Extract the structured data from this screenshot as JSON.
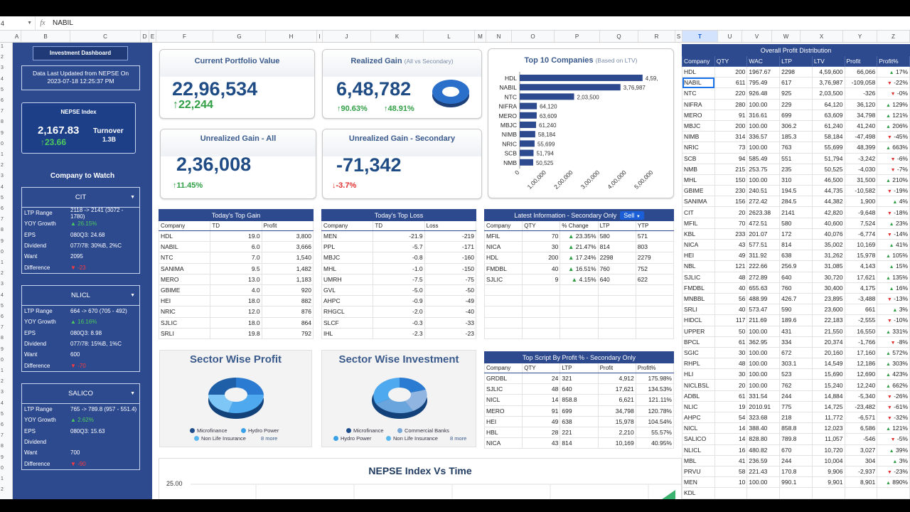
{
  "formula_bar": {
    "cell_ref": "4",
    "fx": "fx",
    "value": "NABIL"
  },
  "columns": [
    "A",
    "B",
    "C",
    "D",
    "E",
    "F",
    "G",
    "H",
    "I",
    "J",
    "K",
    "L",
    "M",
    "N",
    "O",
    "P",
    "Q",
    "R",
    "S",
    "T",
    "U",
    "V",
    "W",
    "X",
    "Y",
    "Z"
  ],
  "rows": [
    "1",
    "2",
    "3",
    "4",
    "5",
    "6",
    "7",
    "8",
    "9",
    "0",
    "1",
    "2",
    "3",
    "4",
    "5",
    "6",
    "7",
    "8",
    "9",
    "0",
    "1",
    "2",
    "3",
    "4",
    "5",
    "6",
    "7",
    "8",
    "9",
    "0",
    "1",
    "2",
    "3",
    "4",
    "5",
    "6",
    "7",
    "8",
    "9",
    "0",
    "1",
    "2"
  ],
  "sidebar": {
    "title": "Investment Dashboard",
    "updated_line1": "Data Last Updated from NEPSE On",
    "updated_line2": "2023-07-18 12:25:37 PM",
    "nepse_label": "NEPSE Index",
    "nepse_value": "2,167.83",
    "nepse_change": "↑23.66",
    "turnover_label": "Turnover",
    "turnover_value": "1.3B",
    "watch_title": "Company to Watch",
    "watch": [
      {
        "name": "CIT",
        "rows": [
          {
            "k": "LTP Range",
            "v": "2118 -> 2141 (3072 - 1780)",
            "cls": ""
          },
          {
            "k": "YOY Growth",
            "v": "▲ 26.15%",
            "cls": "up"
          },
          {
            "k": "EPS",
            "v": "080Q3: 24.68",
            "cls": ""
          },
          {
            "k": "Dividend",
            "v": "077/78: 30%B, 2%C",
            "cls": ""
          },
          {
            "k": "Want",
            "v": "2095",
            "cls": ""
          },
          {
            "k": "Difference",
            "v": "▼ -23",
            "cls": "dn"
          }
        ]
      },
      {
        "name": "NLICL",
        "rows": [
          {
            "k": "LTP Range",
            "v": "664 -> 670 (705 - 492)",
            "cls": ""
          },
          {
            "k": "YOY Growth",
            "v": "▲ 16.16%",
            "cls": "up"
          },
          {
            "k": "EPS",
            "v": "080Q3: 8.98",
            "cls": ""
          },
          {
            "k": "Dividend",
            "v": "077/78: 15%B, 1%C",
            "cls": ""
          },
          {
            "k": "Want",
            "v": "600",
            "cls": ""
          },
          {
            "k": "Difference",
            "v": "▼ -70",
            "cls": "dn"
          }
        ]
      },
      {
        "name": "SALICO",
        "rows": [
          {
            "k": "LTP Range",
            "v": "765 -> 789.8 (957 - 551.4)",
            "cls": ""
          },
          {
            "k": "YOY Growth",
            "v": "▲ 2.62%",
            "cls": "up"
          },
          {
            "k": "EPS",
            "v": "080Q3: 15.63",
            "cls": ""
          },
          {
            "k": "Dividend",
            "v": "",
            "cls": ""
          },
          {
            "k": "Want",
            "v": "700",
            "cls": ""
          },
          {
            "k": "Difference",
            "v": "▼ -90",
            "cls": "dn"
          }
        ]
      }
    ]
  },
  "kpis": {
    "current": {
      "title": "Current Portfolio Value",
      "value": "22,96,534",
      "change": "↑22,244"
    },
    "realized": {
      "title": "Realized Gain",
      "sub": "(All vs Secondary)",
      "value": "6,48,782",
      "c1": "↑90.63%",
      "c2": "↑48.91%"
    },
    "unreal_all": {
      "title": "Unrealized Gain - All",
      "value": "2,36,008",
      "change": "↑11.45%"
    },
    "unreal_sec": {
      "title": "Unrealized Gain - Secondary",
      "value": "-71,342",
      "change": "↓-3.7%"
    }
  },
  "chart_data": {
    "type": "bar",
    "title": "Top 10 Companies",
    "subtitle": "(Based on LTV)",
    "categories": [
      "HDL",
      "NABIL",
      "NTC",
      "NIFRA",
      "MERO",
      "MBJC",
      "NIMB",
      "NRIC",
      "SCB",
      "NMB"
    ],
    "values": [
      459600,
      376987,
      203500,
      64120,
      63609,
      61240,
      58184,
      55699,
      51794,
      50525
    ],
    "labels": [
      "4,59,",
      "3,76,987",
      "2,03,500",
      "64,120",
      "63,609",
      "61,240",
      "58,184",
      "55,699",
      "51,794",
      "50,525"
    ],
    "xticks": [
      "0",
      "1,00,000",
      "2,00,000",
      "3,00,000",
      "4,00,000",
      "5,00,000"
    ],
    "xlim": [
      0,
      500000
    ],
    "color": "#2d4a8f"
  },
  "top_gain": {
    "title": "Today's Top Gain",
    "headers": [
      "Company",
      "TD",
      "Profit"
    ],
    "rows": [
      [
        "HDL",
        "19.0",
        "3,800"
      ],
      [
        "NABIL",
        "6.0",
        "3,666"
      ],
      [
        "NTC",
        "7.0",
        "1,540"
      ],
      [
        "SANIMA",
        "9.5",
        "1,482"
      ],
      [
        "MERO",
        "13.0",
        "1,183"
      ],
      [
        "GBIME",
        "4.0",
        "920"
      ],
      [
        "HEI",
        "18.0",
        "882"
      ],
      [
        "NRIC",
        "12.0",
        "876"
      ],
      [
        "SJLIC",
        "18.0",
        "864"
      ],
      [
        "SRLI",
        "19.8",
        "792"
      ]
    ]
  },
  "top_loss": {
    "title": "Today's Top Loss",
    "headers": [
      "Company",
      "TD",
      "Loss"
    ],
    "rows": [
      [
        "MEN",
        "-21.9",
        "-219"
      ],
      [
        "PPL",
        "-5.7",
        "-171"
      ],
      [
        "MBJC",
        "-0.8",
        "-160"
      ],
      [
        "MHL",
        "-1.0",
        "-150"
      ],
      [
        "UMRH",
        "-7.5",
        "-75"
      ],
      [
        "GVL",
        "-5.0",
        "-50"
      ],
      [
        "AHPC",
        "-0.9",
        "-49"
      ],
      [
        "RHGCL",
        "-2.0",
        "-40"
      ],
      [
        "SLCF",
        "-0.3",
        "-33"
      ],
      [
        "IHL",
        "-2.3",
        "-23"
      ]
    ]
  },
  "latest": {
    "title": "Latest Information  - Secondary Only",
    "filter": "Sell",
    "headers": [
      "Company",
      "QTY",
      "% Change",
      "LTP",
      "YTP"
    ],
    "rows": [
      [
        "MFIL",
        "70",
        "▲ 23.35%",
        "580",
        "571"
      ],
      [
        "NICA",
        "30",
        "▲ 21.47%",
        "814",
        "803"
      ],
      [
        "HDL",
        "200",
        "▲ 17.24%",
        "2298",
        "2279"
      ],
      [
        "FMDBL",
        "40",
        "▲ 16.51%",
        "760",
        "752"
      ],
      [
        "SJLIC",
        "9",
        "▲ 4.15%",
        "640",
        "622"
      ]
    ]
  },
  "top_script": {
    "title": "Top Script By Profit % - Secondary Only",
    "headers": [
      "Company",
      "QTY",
      "LTP",
      "Profit",
      "Profit%"
    ],
    "rows": [
      [
        "GRDBL",
        "24",
        "321",
        "4,912",
        "175.98%"
      ],
      [
        "SJLIC",
        "48",
        "640",
        "17,621",
        "134.53%"
      ],
      [
        "NICL",
        "14",
        "858.8",
        "6,621",
        "121.11%"
      ],
      [
        "MERO",
        "91",
        "699",
        "34,798",
        "120.78%"
      ],
      [
        "HEI",
        "49",
        "638",
        "15,978",
        "104.54%"
      ],
      [
        "HBL",
        "28",
        "221",
        "2,210",
        "55.57%"
      ],
      [
        "NICA",
        "43",
        "814",
        "10,169",
        "40.95%"
      ]
    ]
  },
  "sector_profit": {
    "title": "Sector Wise Profit",
    "legend": [
      "Microfinance",
      "Hydro Power",
      "Non Life Insurance"
    ],
    "more": "8 more",
    "colors": [
      "#1e4d8c",
      "#3aa0e8",
      "#5ab8f0"
    ]
  },
  "sector_invest": {
    "title": "Sector Wise Investment",
    "legend": [
      "Microfinance",
      "Commercial Banks",
      "Hydro Power",
      "Non Life Insurance"
    ],
    "more": "8 more",
    "colors": [
      "#1e4d8c",
      "#7aa8d8",
      "#3aa0e8",
      "#5ab8f0"
    ]
  },
  "line_chart": {
    "title": "NEPSE Index Vs Time",
    "ytick": "25.00"
  },
  "overall": {
    "title": "Overall Profit Distribution",
    "headers": [
      "Company",
      "QTY",
      "WAC",
      "LTP",
      "LTV",
      "Profit",
      "Profit%"
    ],
    "rows": [
      [
        "HDL",
        "200",
        "1967.67",
        "2298",
        "4,59,600",
        "66,066",
        "▲",
        "17%"
      ],
      [
        "NABIL",
        "611",
        "795.49",
        "617",
        "3,76,987",
        "-109,058",
        "▼",
        "-22%"
      ],
      [
        "NTC",
        "220",
        "926.48",
        "925",
        "2,03,500",
        "-326",
        "▼",
        "-0%"
      ],
      [
        "NIFRA",
        "280",
        "100.00",
        "229",
        "64,120",
        "36,120",
        "▲",
        "129%"
      ],
      [
        "MERO",
        "91",
        "316.61",
        "699",
        "63,609",
        "34,798",
        "▲",
        "121%"
      ],
      [
        "MBJC",
        "200",
        "100.00",
        "306.2",
        "61,240",
        "41,240",
        "▲",
        "206%"
      ],
      [
        "NIMB",
        "314",
        "336.57",
        "185.3",
        "58,184",
        "-47,498",
        "▼",
        "-45%"
      ],
      [
        "NRIC",
        "73",
        "100.00",
        "763",
        "55,699",
        "48,399",
        "▲",
        "663%"
      ],
      [
        "SCB",
        "94",
        "585.49",
        "551",
        "51,794",
        "-3,242",
        "▼",
        "-6%"
      ],
      [
        "NMB",
        "215",
        "253.75",
        "235",
        "50,525",
        "-4,030",
        "▼",
        "-7%"
      ],
      [
        "MHL",
        "150",
        "100.00",
        "310",
        "46,500",
        "31,500",
        "▲",
        "210%"
      ],
      [
        "GBIME",
        "230",
        "240.51",
        "194.5",
        "44,735",
        "-10,582",
        "▼",
        "-19%"
      ],
      [
        "SANIMA",
        "156",
        "272.42",
        "284.5",
        "44,382",
        "1,900",
        "▲",
        "4%"
      ],
      [
        "CIT",
        "20",
        "2623.38",
        "2141",
        "42,820",
        "-9,648",
        "▼",
        "-18%"
      ],
      [
        "MFIL",
        "70",
        "472.51",
        "580",
        "40,600",
        "7,524",
        "▲",
        "23%"
      ],
      [
        "KBL",
        "233",
        "201.07",
        "172",
        "40,076",
        "-6,774",
        "▼",
        "-14%"
      ],
      [
        "NICA",
        "43",
        "577.51",
        "814",
        "35,002",
        "10,169",
        "▲",
        "41%"
      ],
      [
        "HEI",
        "49",
        "311.92",
        "638",
        "31,262",
        "15,978",
        "▲",
        "105%"
      ],
      [
        "NBL",
        "121",
        "222.66",
        "256.9",
        "31,085",
        "4,143",
        "▲",
        "15%"
      ],
      [
        "SJLIC",
        "48",
        "272.89",
        "640",
        "30,720",
        "17,621",
        "▲",
        "135%"
      ],
      [
        "FMDBL",
        "40",
        "655.63",
        "760",
        "30,400",
        "4,175",
        "▲",
        "16%"
      ],
      [
        "MNBBL",
        "56",
        "488.99",
        "426.7",
        "23,895",
        "-3,488",
        "▼",
        "-13%"
      ],
      [
        "SRLI",
        "40",
        "573.47",
        "590",
        "23,600",
        "661",
        "▲",
        "3%"
      ],
      [
        "HIDCL",
        "117",
        "211.69",
        "189.6",
        "22,183",
        "-2,555",
        "▼",
        "-10%"
      ],
      [
        "UPPER",
        "50",
        "100.00",
        "431",
        "21,550",
        "16,550",
        "▲",
        "331%"
      ],
      [
        "BPCL",
        "61",
        "362.95",
        "334",
        "20,374",
        "-1,766",
        "▼",
        "-8%"
      ],
      [
        "SGIC",
        "30",
        "100.00",
        "672",
        "20,160",
        "17,160",
        "▲",
        "572%"
      ],
      [
        "RHPL",
        "48",
        "100.00",
        "303.1",
        "14,549",
        "12,186",
        "▲",
        "303%"
      ],
      [
        "HLI",
        "30",
        "100.00",
        "523",
        "15,690",
        "12,690",
        "▲",
        "423%"
      ],
      [
        "NICLBSL",
        "20",
        "100.00",
        "762",
        "15,240",
        "12,240",
        "▲",
        "662%"
      ],
      [
        "ADBL",
        "61",
        "331.54",
        "244",
        "14,884",
        "-5,340",
        "▼",
        "-26%"
      ],
      [
        "NLIC",
        "19",
        "2010.91",
        "775",
        "14,725",
        "-23,482",
        "▼",
        "-61%"
      ],
      [
        "AHPC",
        "54",
        "323.68",
        "218",
        "11,772",
        "-6,571",
        "▼",
        "-32%"
      ],
      [
        "NICL",
        "14",
        "388.40",
        "858.8",
        "12,023",
        "6,586",
        "▲",
        "121%"
      ],
      [
        "SALICO",
        "14",
        "828.80",
        "789.8",
        "11,057",
        "-546",
        "▼",
        "-5%"
      ],
      [
        "NLICL",
        "16",
        "480.82",
        "670",
        "10,720",
        "3,027",
        "▲",
        "39%"
      ],
      [
        "MBL",
        "41",
        "236.59",
        "244",
        "10,004",
        "304",
        "▲",
        "3%"
      ],
      [
        "PRVU",
        "58",
        "221.43",
        "170.8",
        "9,906",
        "-2,937",
        "▼",
        "-23%"
      ],
      [
        "MEN",
        "10",
        "100.00",
        "990.1",
        "9,901",
        "8,901",
        "▲",
        "890%"
      ],
      [
        "KDL",
        "",
        "",
        "",
        "",
        "",
        "",
        ""
      ]
    ]
  }
}
